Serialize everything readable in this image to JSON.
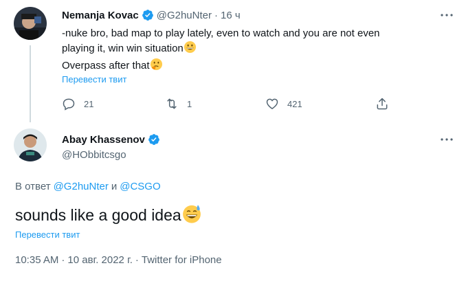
{
  "tweet1": {
    "author_name": "Nemanja Kovac",
    "handle": "@G2huNter",
    "separator": "·",
    "time": "16 ч",
    "text_line1": "-nuke bro, bad map to play lately, even to watch and you are not even",
    "text_line2": "playing it, win win situation",
    "text_line3": "Overpass after that",
    "translate_label": "Перевести твит",
    "reply_count": "21",
    "retweet_count": "1",
    "like_count": "421"
  },
  "tweet2": {
    "author_name": "Abay Khassenov",
    "handle": "@HObbitcsgo",
    "reply_prefix": "В ответ",
    "reply_to_1": "@G2huNter",
    "reply_and": "и",
    "reply_to_2": "@CSGO",
    "text": "sounds like a good idea",
    "translate_label": "Перевести твит",
    "meta_time": "10:35 AM",
    "meta_sep1": "·",
    "meta_date": "10 авг. 2022 г.",
    "meta_sep2": "·",
    "meta_source": "Twitter for iPhone"
  },
  "colors": {
    "accent": "#1d9bf0",
    "secondary_text": "#536471",
    "thread_line": "#cfd9de"
  }
}
